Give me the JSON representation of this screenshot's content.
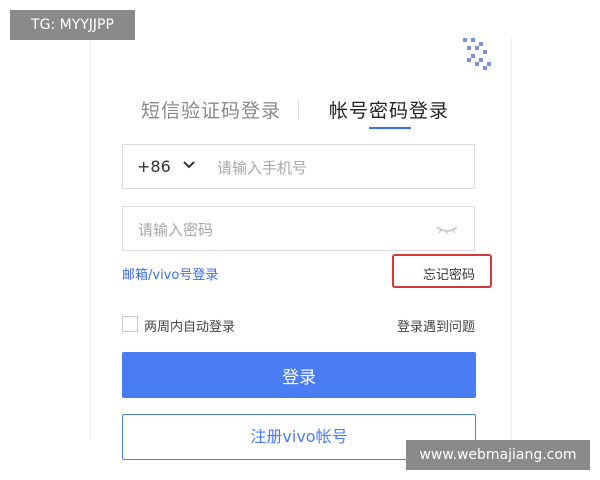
{
  "tabs": {
    "sms_login": "短信验证码登录",
    "password_login": "帐号密码登录"
  },
  "phone": {
    "country_code": "+86",
    "placeholder": "请输入手机号",
    "value": ""
  },
  "password": {
    "placeholder": "请输入密码",
    "value": ""
  },
  "links": {
    "alt_login": "邮箱/vivo号登录",
    "forgot": "忘记密码"
  },
  "options": {
    "remember": "两周内自动登录",
    "trouble": "登录遇到问题"
  },
  "buttons": {
    "login": "登录",
    "register": "注册vivo帐号"
  },
  "watermarks": {
    "top": "TG: MYYJJPP",
    "bottom": "www.webmajiang.com"
  },
  "colors": {
    "accent": "#4a7cf3",
    "highlight": "#d23a3a"
  }
}
